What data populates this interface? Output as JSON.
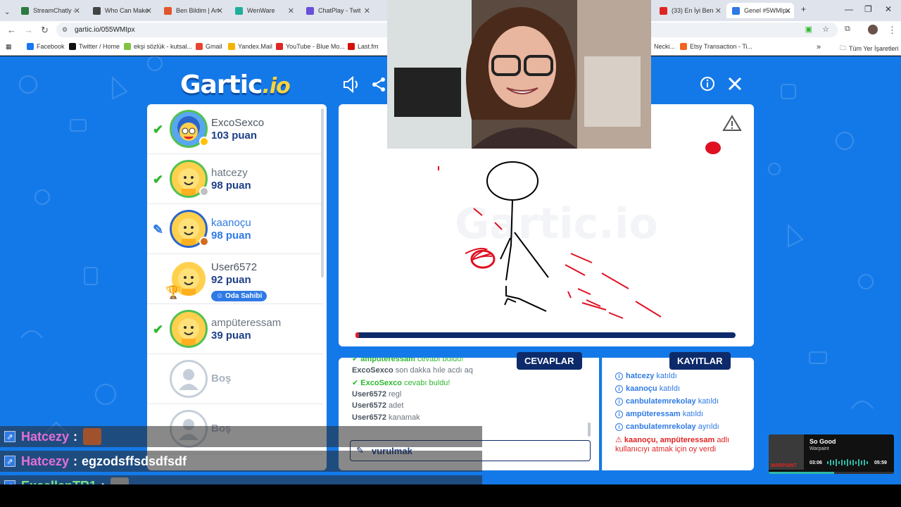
{
  "browser": {
    "tabs": [
      {
        "label": "StreamChatly -",
        "color": "#2c7a3f"
      },
      {
        "label": "Who Can Make",
        "color": "#444444"
      },
      {
        "label": "Ben Bildim | An",
        "color": "#e0552c"
      },
      {
        "label": "WenWare",
        "color": "#1fae9c"
      },
      {
        "label": "ChatPlay - Twit",
        "color": "#6a4fd8"
      },
      {
        "label": "(33) En İyi Ben",
        "color": "#e02424"
      },
      {
        "label": "Genel #5WMIpx",
        "color": "#2f7ae5"
      }
    ],
    "url": "gartic.io/055WMIpx",
    "bookmarks": [
      {
        "label": "Facebook",
        "color": "#1877f2"
      },
      {
        "label": "Twitter / Home",
        "color": "#111111"
      },
      {
        "label": "ekşi sözlük - kutsal...",
        "color": "#81c341"
      },
      {
        "label": "Gmail",
        "color": "#e94235"
      },
      {
        "label": "Yandex.Mail",
        "color": "#f5b300"
      },
      {
        "label": "YouTube - Blue Mo...",
        "color": "#e02424"
      },
      {
        "label": "Last.fm",
        "color": "#d51007"
      },
      {
        "label": "Necki...",
        "color": "#777777"
      },
      {
        "label": "Etsy Transaction - Ti...",
        "color": "#f1641e"
      }
    ],
    "all_bookmarks": "Tüm Yer İşaretleri"
  },
  "game": {
    "logo": "Gartic",
    "logo_suffix": ".io",
    "players": [
      {
        "name": "ExcoSexco",
        "score": "103 puan",
        "status": "check"
      },
      {
        "name": "hatcezy",
        "score": "98 puan",
        "status": "check"
      },
      {
        "name": "kaanoçu",
        "score": "98 puan",
        "status": "drawing"
      },
      {
        "name": "User6572",
        "score": "92 puan",
        "status": "none",
        "badge": "Oda Sahibi"
      },
      {
        "name": "ampüteressam",
        "score": "39 puan",
        "status": "check"
      },
      {
        "name": "Boş"
      },
      {
        "name": "Boş"
      }
    ],
    "timer_fraction": 0.01,
    "tab_answers": "CEVAPLAR",
    "tab_logs": "KAYITLAR",
    "answers": [
      {
        "user": "ampüteressam",
        "text": "cevabı buldu!",
        "good": true
      },
      {
        "user": "ExcoSexco",
        "text": "son dakka hıle acdı aq",
        "good": false
      },
      {
        "user": "ExcoSexco",
        "text": "cevabı buldu!",
        "good": true
      },
      {
        "user": "User6572",
        "text": "regl",
        "good": false
      },
      {
        "user": "User6572",
        "text": "adet",
        "good": false
      },
      {
        "user": "User6572",
        "text": "kanamak",
        "good": false
      }
    ],
    "input_value": "vurulmak",
    "logs": [
      {
        "user": "hatcezy",
        "text": "katıldı"
      },
      {
        "user": "kaanoçu",
        "text": "katıldı"
      },
      {
        "user": "canbulatemrekolay",
        "text": "katıldı"
      },
      {
        "user": "ampüteressam",
        "text": "katıldı"
      },
      {
        "user": "canbulatemrekolay",
        "text": "ayrıldı"
      }
    ],
    "vote_log": {
      "users": "kaanoçu, ampüteressam",
      "text1": "adlı",
      "text2": "kullanıcıyı atmak için oy verdi"
    }
  },
  "stream_chat": [
    {
      "user": "Hatcezy",
      "sep": ":",
      "text": "",
      "color": "#e36fd6"
    },
    {
      "user": "Hatcezy",
      "sep": ":",
      "text": "egzodsffsdsdfsdf",
      "color": "#e36fd6"
    },
    {
      "user": "ExcellenTR1",
      "sep": ":",
      "text": "",
      "color": "#7ce08a"
    }
  ],
  "music": {
    "title": "So Good",
    "artist": "Warpaint",
    "album_text": "WARPAINT",
    "elapsed": "03:06",
    "total": "05:59",
    "progress": 0.52
  }
}
